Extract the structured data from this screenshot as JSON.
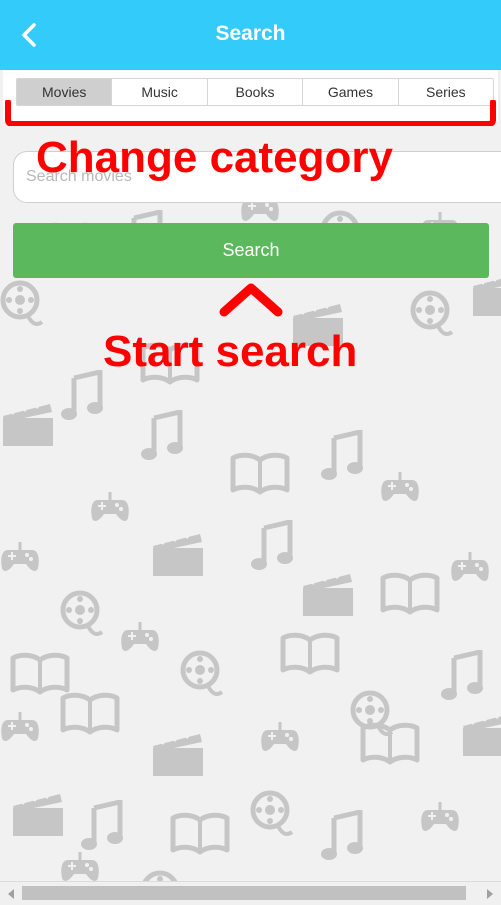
{
  "header": {
    "title": "Search",
    "back_icon": "chevron-left-icon",
    "background": "#33ccfa"
  },
  "tabs": {
    "items": [
      {
        "label": "Movies",
        "active": true
      },
      {
        "label": "Music",
        "active": false
      },
      {
        "label": "Books",
        "active": false
      },
      {
        "label": "Games",
        "active": false
      },
      {
        "label": "Series",
        "active": false
      }
    ]
  },
  "search": {
    "placeholder": "Search movies",
    "value": "",
    "button_label": "Search",
    "button_color": "#5cb85c"
  },
  "annotations": {
    "category": "Change category",
    "start": "Start search",
    "color": "#ff0000"
  },
  "background_pattern": {
    "icons": [
      "book-icon",
      "music-note-icon",
      "gamepad-icon",
      "film-reel-icon",
      "clapperboard-icon"
    ],
    "color": "#c6c6c6"
  }
}
